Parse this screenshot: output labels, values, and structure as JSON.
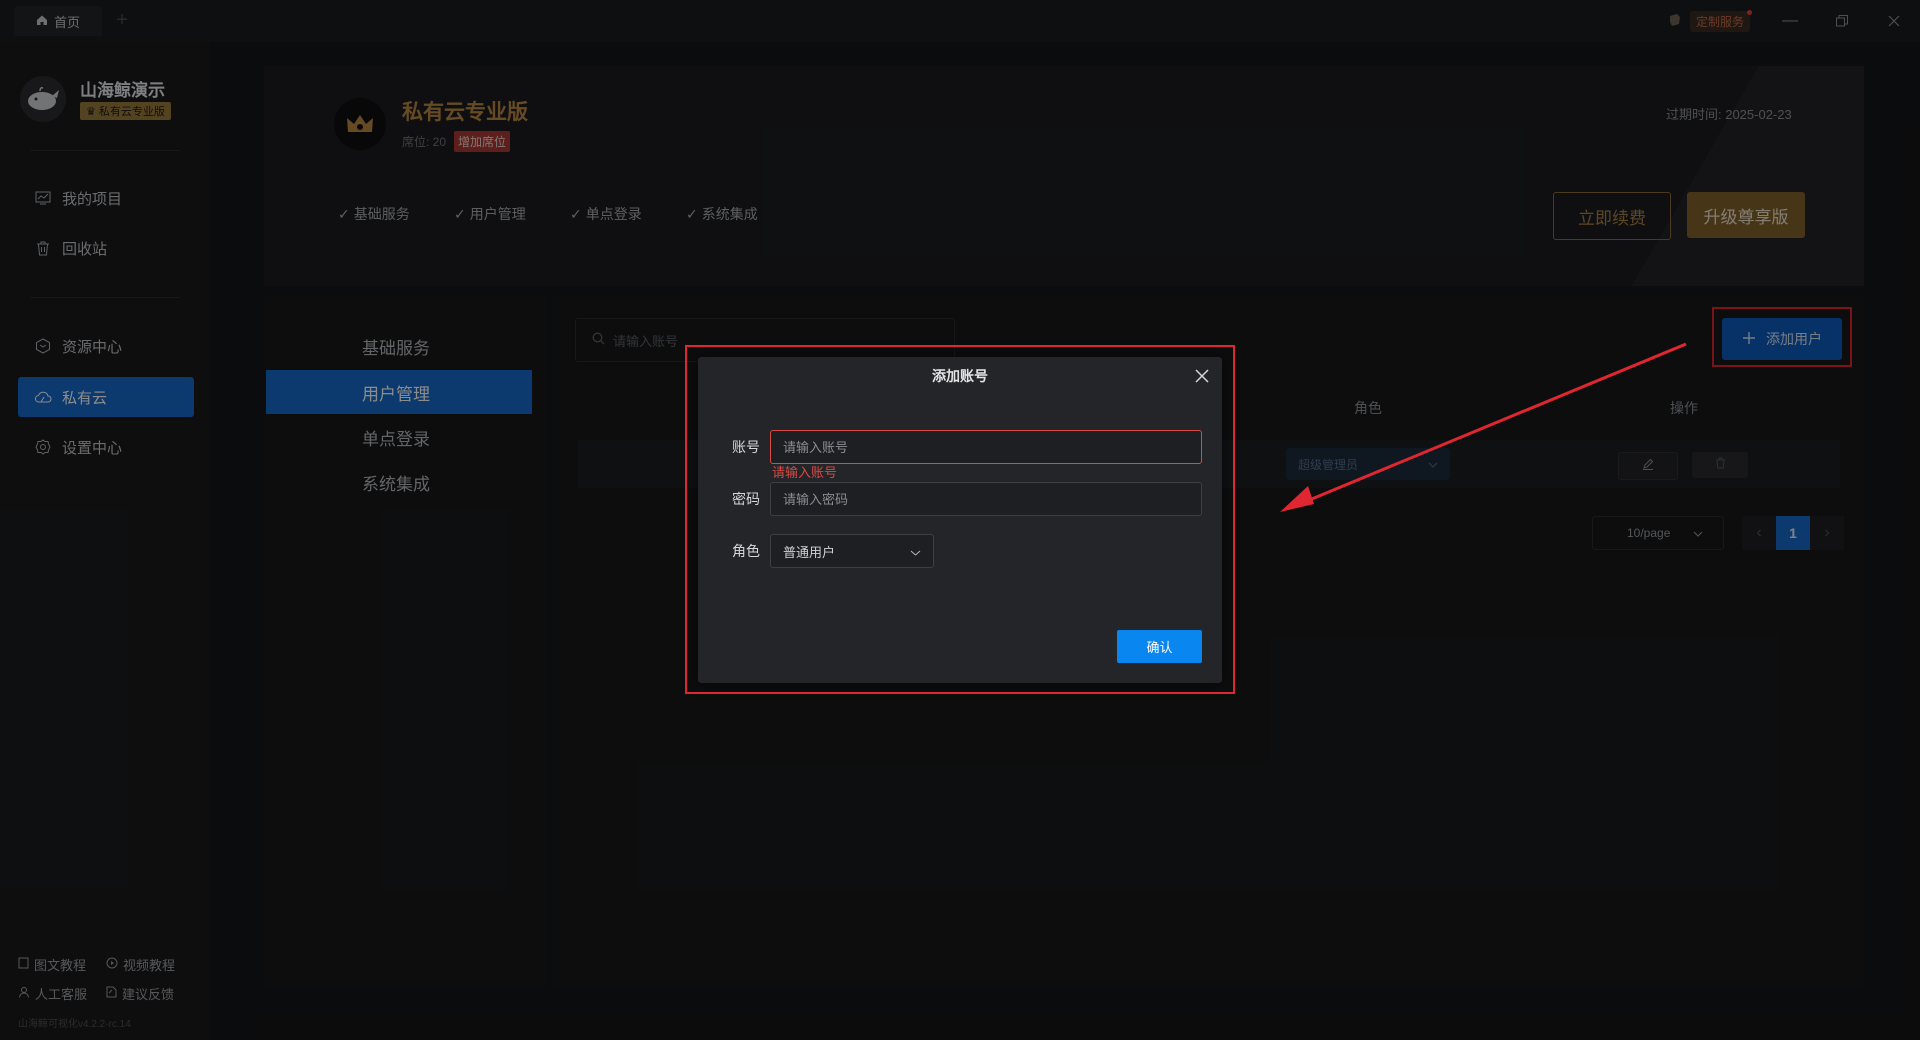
{
  "titlebar": {
    "tab_home": "首页",
    "custom_service": "定制服务"
  },
  "sidebar": {
    "brand_name": "山海鲸演示",
    "brand_badge": "私有云专业版",
    "items": [
      {
        "label": "我的项目",
        "icon": "project-icon"
      },
      {
        "label": "回收站",
        "icon": "trash-icon"
      },
      {
        "label": "资源中心",
        "icon": "resource-icon"
      },
      {
        "label": "私有云",
        "icon": "cloud-icon",
        "active": true
      },
      {
        "label": "设置中心",
        "icon": "gear-icon"
      }
    ],
    "footer": {
      "doc_tutorial": "图文教程",
      "video_tutorial": "视频教程",
      "support": "人工客服",
      "feedback": "建议反馈"
    },
    "version": "山海鲸可视化v4.2.2-rc.14"
  },
  "header": {
    "plan_title": "私有云专业版",
    "seats": "席位: 20",
    "add_seat": "增加席位",
    "expire": "过期时间: 2025-02-23",
    "features": [
      "基础服务",
      "用户管理",
      "单点登录",
      "系统集成"
    ],
    "renew_label": "立即续费",
    "upgrade_label": "升级尊享版"
  },
  "left_menu": {
    "items": [
      "基础服务",
      "用户管理",
      "单点登录",
      "系统集成"
    ],
    "active_index": 1
  },
  "main": {
    "search_placeholder": "请输入账号",
    "add_user_label": "添加用户",
    "columns": {
      "role": "角色",
      "actions": "操作"
    },
    "row_role": "超级管理员",
    "page_size": "10/page",
    "current_page": "1"
  },
  "modal": {
    "title": "添加账号",
    "account_label": "账号",
    "account_placeholder": "请输入账号",
    "account_error": "请输入账号",
    "password_label": "密码",
    "password_placeholder": "请输入密码",
    "role_label": "角色",
    "role_value": "普通用户",
    "confirm_label": "确认"
  },
  "colors": {
    "accent_blue": "#1769c9",
    "gold": "#b88843",
    "highlight_red": "#e02630"
  }
}
